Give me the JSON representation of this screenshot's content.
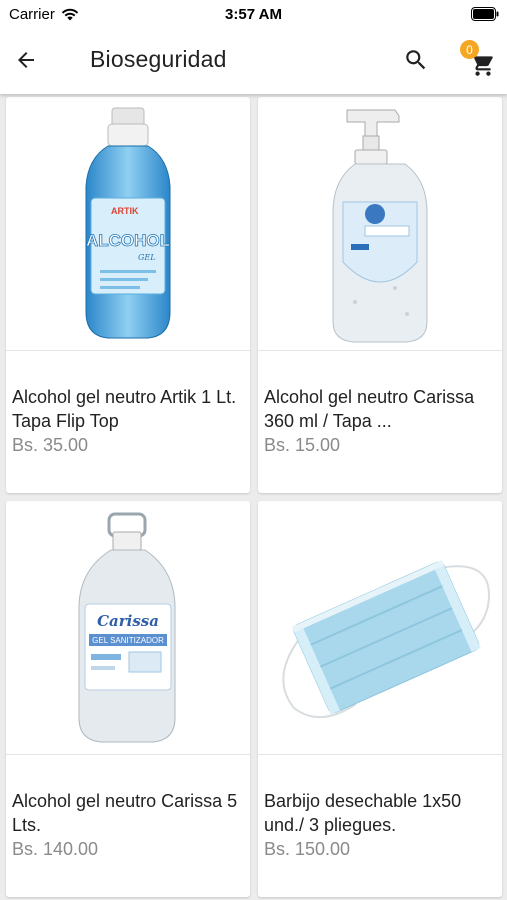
{
  "status_bar": {
    "carrier": "Carrier",
    "time": "3:57 AM"
  },
  "app_bar": {
    "title": "Bioseguridad",
    "cart_count": "0",
    "back_icon": "arrow-back-icon",
    "search_icon": "search-icon",
    "cart_icon": "shopping-cart-icon"
  },
  "products": [
    {
      "name": "Alcohol gel neutro Artik 1 Lt. Tapa Flip Top",
      "price": "Bs. 35.00"
    },
    {
      "name": "Alcohol gel neutro Carissa 360 ml / Tapa ...",
      "price": "Bs. 15.00"
    },
    {
      "name": "Alcohol gel neutro Carissa 5 Lts.",
      "price": "Bs. 140.00"
    },
    {
      "name": "Barbijo  desechable 1x50 und./ 3 pliegues.",
      "price": "Bs. 150.00"
    }
  ],
  "image_labels": {
    "artik_brand": "ARTIK",
    "artik_label": "ALCOHOL",
    "artik_sub": "GEL",
    "carissa_brand": "Carissa",
    "carissa_label": "GEL SANITIZADOR"
  },
  "colors": {
    "badge": "#f5a623",
    "price": "#8a8a8a",
    "background": "#ececec"
  }
}
